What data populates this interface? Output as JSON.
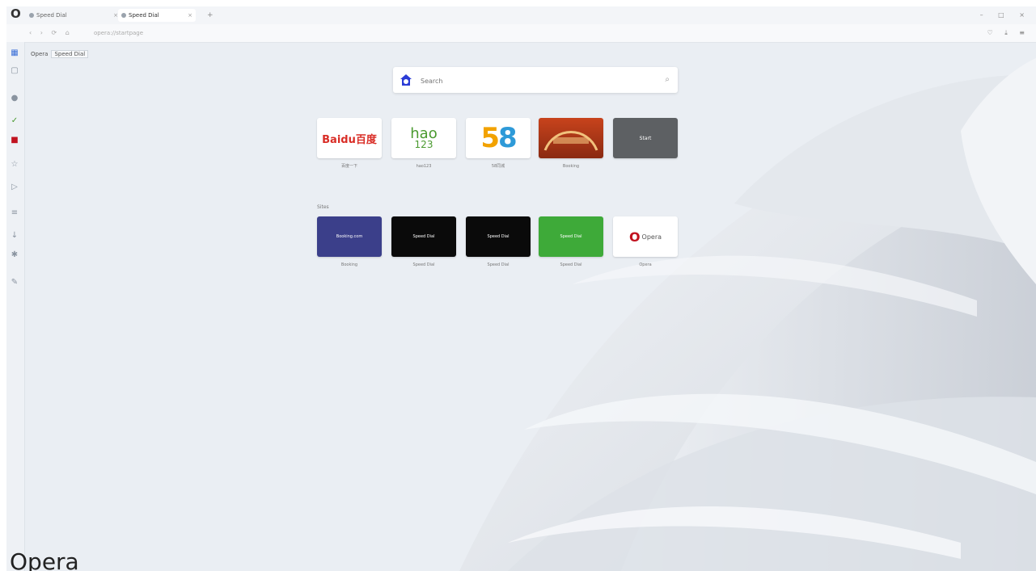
{
  "caption": "Opera",
  "tabs": [
    {
      "label": "Speed Dial",
      "active": false
    },
    {
      "label": "Speed Dial",
      "active": true
    }
  ],
  "address": {
    "url": "opera://startpage"
  },
  "bookmarks": [
    "Opera",
    "Speed Dial"
  ],
  "search": {
    "placeholder": "Search"
  },
  "speed_dial_row1": [
    {
      "caption": "百度一下"
    },
    {
      "caption": "hao123"
    },
    {
      "caption": "58同城"
    },
    {
      "caption": "Booking"
    },
    {
      "caption": "Start"
    }
  ],
  "speed_dial_row2": [
    {
      "label": "Booking.com",
      "caption": "Booking"
    },
    {
      "label": "Speed Dial",
      "caption": "Speed Dial"
    },
    {
      "label": "Speed Dial",
      "caption": "Speed Dial"
    },
    {
      "label": "Speed Dial",
      "caption": "Speed Dial"
    },
    {
      "label": "Opera",
      "caption": "Opera"
    }
  ],
  "tile_text": {
    "baidu": "Baidu百度",
    "hao_top": "hao",
    "hao_num": "123",
    "w58_five": "5",
    "w58_eight": "8",
    "grey_label": "Start",
    "opera_o": "O",
    "opera_label": "Opera"
  },
  "section_label": "Sites",
  "colors": {
    "accent": "#d92d26",
    "opera": "#c1121f"
  }
}
